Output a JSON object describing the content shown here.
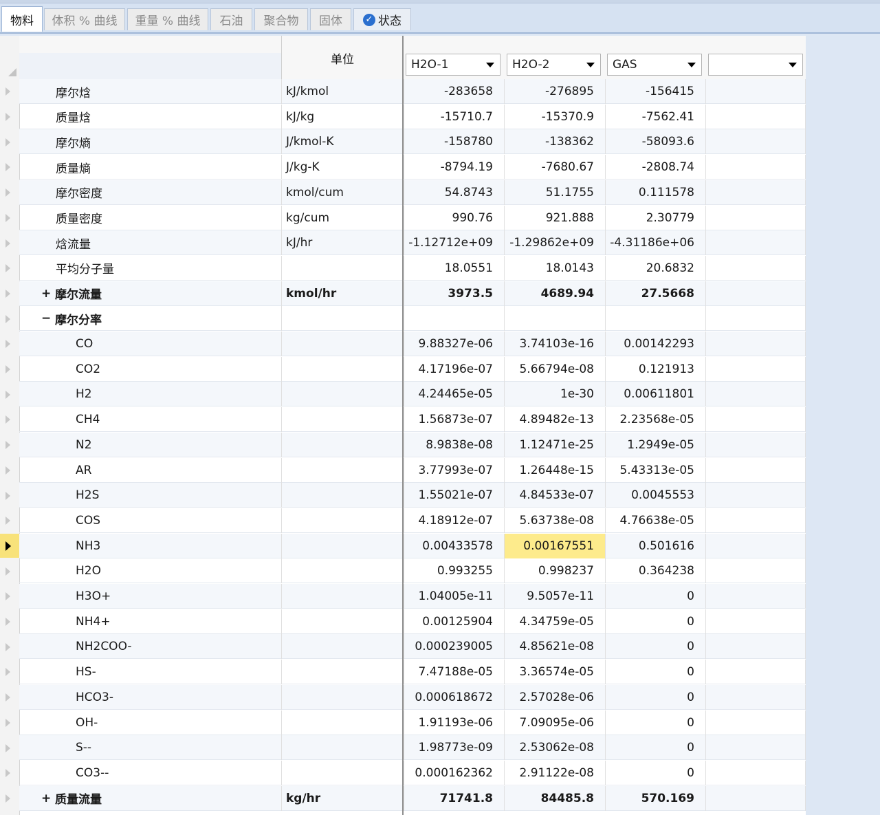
{
  "tabs": [
    {
      "label": "物料",
      "active": true
    },
    {
      "label": "体积 % 曲线"
    },
    {
      "label": "重量 % 曲线"
    },
    {
      "label": "石油"
    },
    {
      "label": "聚合物"
    },
    {
      "label": "固体"
    },
    {
      "label": "状态",
      "icon": "check-circle-icon"
    }
  ],
  "header": {
    "unit_label": "单位",
    "streams": [
      "H2O-1",
      "H2O-2",
      "GAS",
      ""
    ]
  },
  "rows": [
    {
      "label": "摩尔焓",
      "unit": "kJ/kmol",
      "v": [
        "-283658",
        "-276895",
        "-156415",
        ""
      ]
    },
    {
      "label": "质量焓",
      "unit": "kJ/kg",
      "v": [
        "-15710.7",
        "-15370.9",
        "-7562.41",
        ""
      ]
    },
    {
      "label": "摩尔熵",
      "unit": "J/kmol-K",
      "v": [
        "-158780",
        "-138362",
        "-58093.6",
        ""
      ]
    },
    {
      "label": "质量熵",
      "unit": "J/kg-K",
      "v": [
        "-8794.19",
        "-7680.67",
        "-2808.74",
        ""
      ]
    },
    {
      "label": "摩尔密度",
      "unit": "kmol/cum",
      "v": [
        "54.8743",
        "51.1755",
        "0.111578",
        ""
      ]
    },
    {
      "label": "质量密度",
      "unit": "kg/cum",
      "v": [
        "990.76",
        "921.888",
        "2.30779",
        ""
      ]
    },
    {
      "label": "焓流量",
      "unit": "kJ/hr",
      "v": [
        "-1.12712e+09",
        "-1.29862e+09",
        "-4.31186e+06",
        ""
      ]
    },
    {
      "label": "平均分子量",
      "unit": "",
      "v": [
        "18.0551",
        "18.0143",
        "20.6832",
        ""
      ]
    },
    {
      "label": "摩尔流量",
      "unit": "kmol/hr",
      "v": [
        "3973.5",
        "4689.94",
        "27.5668",
        ""
      ],
      "bold": true,
      "expander": "+"
    },
    {
      "label": "摩尔分率",
      "unit": "",
      "v": [
        "",
        "",
        "",
        ""
      ],
      "bold": true,
      "expander": "−"
    },
    {
      "label": "CO",
      "unit": "",
      "v": [
        "9.88327e-06",
        "3.74103e-16",
        "0.00142293",
        ""
      ],
      "indent": 2
    },
    {
      "label": "CO2",
      "unit": "",
      "v": [
        "4.17196e-07",
        "5.66794e-08",
        "0.121913",
        ""
      ],
      "indent": 2
    },
    {
      "label": "H2",
      "unit": "",
      "v": [
        "4.24465e-05",
        "1e-30",
        "0.00611801",
        ""
      ],
      "indent": 2
    },
    {
      "label": "CH4",
      "unit": "",
      "v": [
        "1.56873e-07",
        "4.89482e-13",
        "2.23568e-05",
        ""
      ],
      "indent": 2
    },
    {
      "label": "N2",
      "unit": "",
      "v": [
        "8.9838e-08",
        "1.12471e-25",
        "1.2949e-05",
        ""
      ],
      "indent": 2
    },
    {
      "label": "AR",
      "unit": "",
      "v": [
        "3.77993e-07",
        "1.26448e-15",
        "5.43313e-05",
        ""
      ],
      "indent": 2
    },
    {
      "label": "H2S",
      "unit": "",
      "v": [
        "1.55021e-07",
        "4.84533e-07",
        "0.0045553",
        ""
      ],
      "indent": 2
    },
    {
      "label": "COS",
      "unit": "",
      "v": [
        "4.18912e-07",
        "5.63738e-08",
        "4.76638e-05",
        ""
      ],
      "indent": 2
    },
    {
      "label": "NH3",
      "unit": "",
      "v": [
        "0.00433578",
        "0.00167551",
        "0.501616",
        ""
      ],
      "indent": 2,
      "current": true
    },
    {
      "label": "H2O",
      "unit": "",
      "v": [
        "0.993255",
        "0.998237",
        "0.364238",
        ""
      ],
      "indent": 2
    },
    {
      "label": "H3O+",
      "unit": "",
      "v": [
        "1.04005e-11",
        "9.5057e-11",
        "0",
        ""
      ],
      "indent": 2
    },
    {
      "label": "NH4+",
      "unit": "",
      "v": [
        "0.00125904",
        "4.34759e-05",
        "0",
        ""
      ],
      "indent": 2
    },
    {
      "label": "NH2COO-",
      "unit": "",
      "v": [
        "0.000239005",
        "4.85621e-08",
        "0",
        ""
      ],
      "indent": 2
    },
    {
      "label": "HS-",
      "unit": "",
      "v": [
        "7.47188e-05",
        "3.36574e-05",
        "0",
        ""
      ],
      "indent": 2
    },
    {
      "label": "HCO3-",
      "unit": "",
      "v": [
        "0.000618672",
        "2.57028e-06",
        "0",
        ""
      ],
      "indent": 2
    },
    {
      "label": "OH-",
      "unit": "",
      "v": [
        "1.91193e-06",
        "7.09095e-06",
        "0",
        ""
      ],
      "indent": 2
    },
    {
      "label": "S--",
      "unit": "",
      "v": [
        "1.98773e-09",
        "2.53062e-08",
        "0",
        ""
      ],
      "indent": 2
    },
    {
      "label": "CO3--",
      "unit": "",
      "v": [
        "0.000162362",
        "2.91122e-08",
        "0",
        ""
      ],
      "indent": 2
    },
    {
      "label": "质量流量",
      "unit": "kg/hr",
      "v": [
        "71741.8",
        "84485.8",
        "570.169",
        ""
      ],
      "bold": true,
      "expander": "+"
    }
  ],
  "selected_cell": {
    "row": 18,
    "col": 1
  },
  "colors": {
    "selection": "#fdeb8c",
    "accent": "#2a6fcf"
  }
}
